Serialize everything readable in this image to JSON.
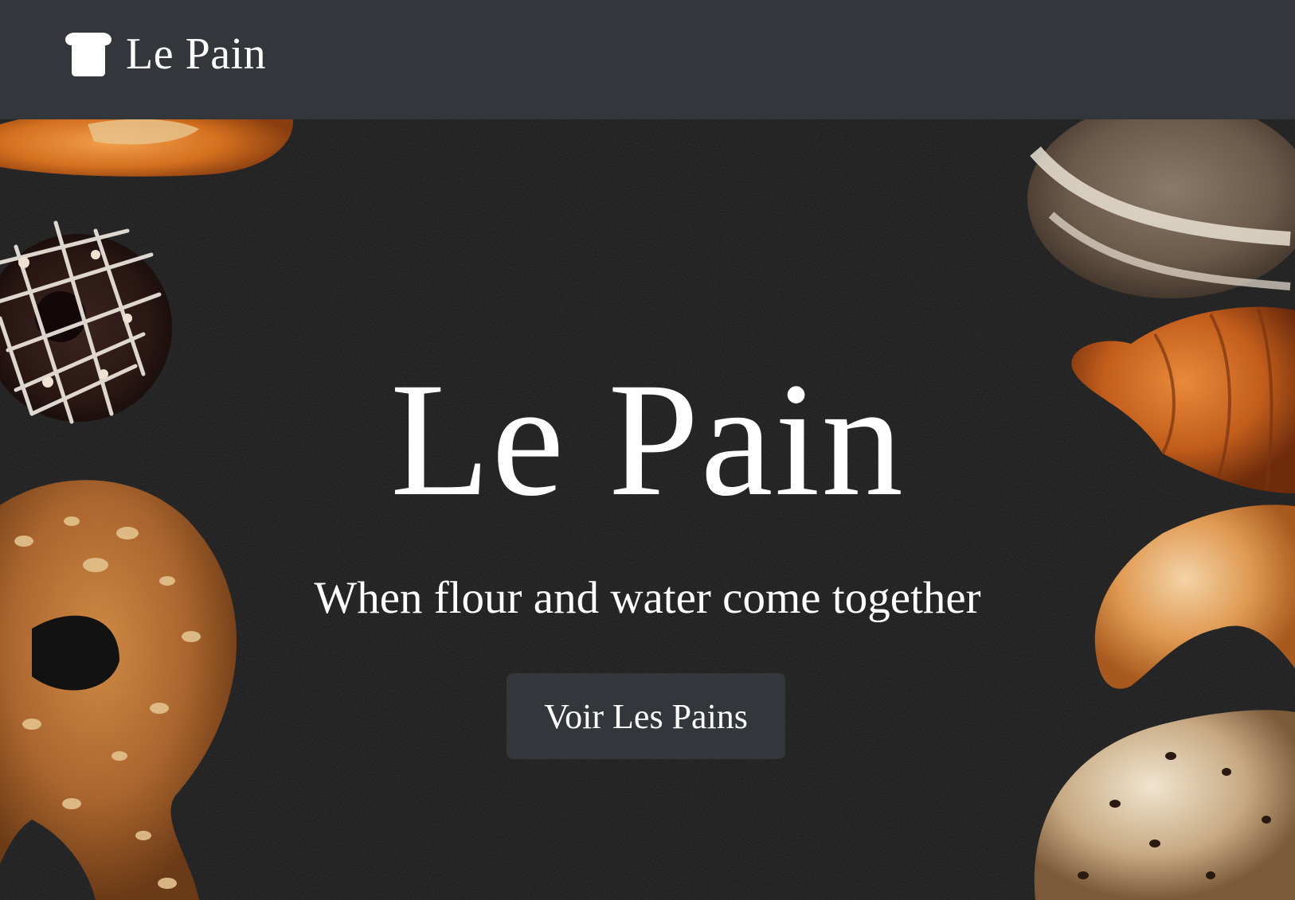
{
  "navbar": {
    "brand_label": "Le Pain",
    "brand_icon": "bread-icon",
    "background": "#33363a"
  },
  "hero": {
    "title": "Le Pain",
    "subtitle": "When flour and water come together",
    "cta_label": "Voir Les Pains",
    "background": "#121212",
    "image_contents": [
      "baguette",
      "chocolate-donut",
      "pretzel",
      "round-loaf",
      "croissant",
      "crescent-roll",
      "raisin-loaf"
    ]
  }
}
